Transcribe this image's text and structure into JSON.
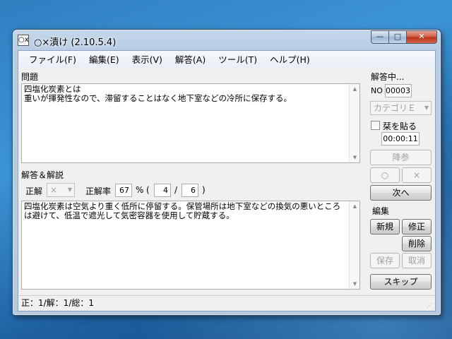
{
  "window": {
    "title": "○×漬け (2.10.5.4)",
    "app_icon": "○x"
  },
  "caption": {
    "min": "—",
    "max": "□",
    "close": "✕"
  },
  "menu": [
    "ファイル(F)",
    "編集(E)",
    "表示(V)",
    "解答(A)",
    "ツール(T)",
    "ヘルプ(H)"
  ],
  "question": {
    "label": "問題",
    "text": "四塩化炭素とは\n重いが揮発性なので、滞留することはなく地下室などの冷所に保存する。"
  },
  "answer": {
    "label": "解答＆解説",
    "correct_label": "正解",
    "correct_value": "×",
    "rate_label": "正解率",
    "rate_value": "67",
    "percent_sign": "%",
    "open_paren": "(",
    "count_correct": "4",
    "slash": "/",
    "count_total": "6",
    "close_paren": ")",
    "text": "四塩化炭素は空気より重く低所に停留する。保管場所は地下室などの換気の悪いところは避けて、低温で遮光して気密容器を使用して貯蔵する。"
  },
  "side": {
    "status_label": "解答中...",
    "no_label": "NO",
    "no_value": "00003",
    "category": "カテゴリＥ",
    "sticky_label": "栞を貼る",
    "timer": "00:00:11",
    "surrender": "降参",
    "maru": "○",
    "batsu": "×",
    "next": "次へ"
  },
  "edit": {
    "label": "編集",
    "new": "新規",
    "modify": "修正",
    "delete": "削除",
    "save": "保存",
    "cancel": "取消",
    "skip": "スキップ"
  },
  "status": {
    "text": "正：1/解：1/総：1",
    "grip": "⋰"
  },
  "icons": {
    "scroll_up": "▲",
    "scroll_down": "▼",
    "dropdown": "▼"
  }
}
